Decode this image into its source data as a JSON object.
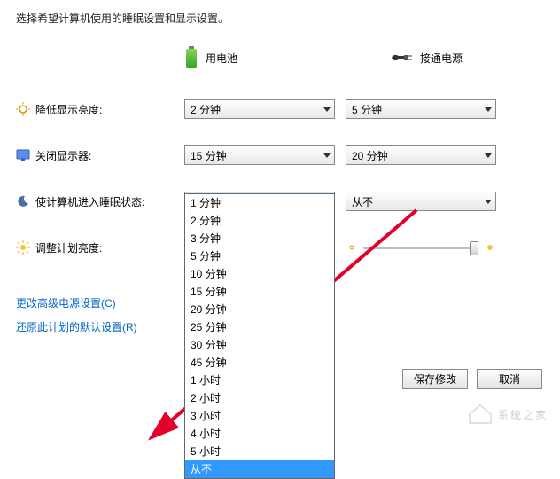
{
  "heading": "选择希望计算机使用的睡眠设置和显示设置。",
  "columns": {
    "battery": "用电池",
    "plugged": "接通电源"
  },
  "rows": {
    "dim": {
      "label": "降低显示亮度:",
      "battery": "2 分钟",
      "plugged": "5 分钟"
    },
    "off": {
      "label": "关闭显示器:",
      "battery": "15 分钟",
      "plugged": "20 分钟"
    },
    "sleep": {
      "label": "使计算机进入睡眠状态:",
      "battery": "从不",
      "plugged": "从不"
    },
    "bright": {
      "label": "调整计划亮度:"
    }
  },
  "dropdown_options": [
    "1 分钟",
    "2 分钟",
    "3 分钟",
    "5 分钟",
    "10 分钟",
    "15 分钟",
    "20 分钟",
    "25 分钟",
    "30 分钟",
    "45 分钟",
    "1 小时",
    "2 小时",
    "3 小时",
    "4 小时",
    "5 小时",
    "从不"
  ],
  "dropdown_selected": "从不",
  "links": {
    "advanced": "更改高级电源设置(C)",
    "restore": "还原此计划的默认设置(R)"
  },
  "buttons": {
    "save": "保存修改",
    "cancel": "取消"
  },
  "watermark": "系统之家",
  "colors": {
    "link": "#0066cc",
    "hl": "#3399ff"
  }
}
